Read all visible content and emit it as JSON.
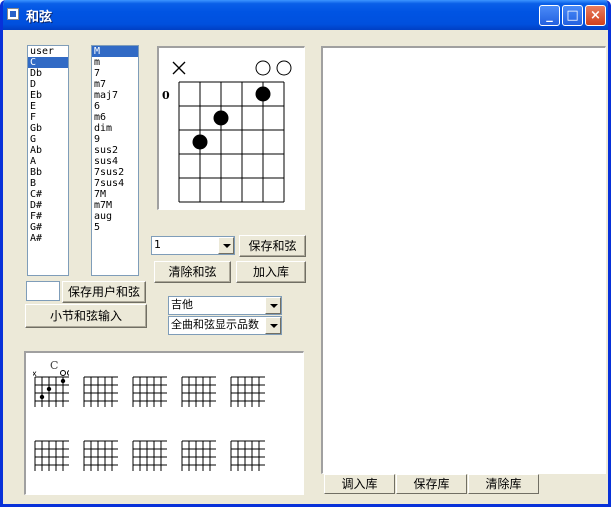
{
  "window": {
    "title": "和弦",
    "min_label": "_",
    "max_label": "□",
    "close_label": "×"
  },
  "root_list": {
    "items": [
      "user",
      "C",
      "Db",
      "D",
      "Eb",
      "E",
      "F",
      "Gb",
      "G",
      "Ab",
      "A",
      "Bb",
      "B",
      "C#",
      "D#",
      "F#",
      "G#",
      "A#"
    ],
    "selected": 1
  },
  "type_list": {
    "items": [
      "M",
      "m",
      "7",
      "m7",
      "maj7",
      "6",
      "m6",
      "dim",
      "9",
      "sus2",
      "sus4",
      "7sus2",
      "7sus4",
      "7M",
      "m7M",
      "aug",
      "5"
    ],
    "selected": 0
  },
  "chord_diagram": {
    "fret_label": "0",
    "strings": [
      "x",
      "",
      "",
      "",
      "o",
      "o"
    ],
    "dots": [
      {
        "string": 5,
        "fret": 1
      },
      {
        "string": 3,
        "fret": 2
      },
      {
        "string": 2,
        "fret": 3
      }
    ]
  },
  "fret_select": {
    "value": "1"
  },
  "buttons": {
    "save_chord": "保存和弦",
    "clear_chord": "清除和弦",
    "add_library": "加入库",
    "save_user_chord": "保存用户和弦",
    "measure_input": "小节和弦输入"
  },
  "user_chord_input": {
    "value": ""
  },
  "instrument_select": {
    "value": "吉他"
  },
  "display_select": {
    "value": "全曲和弦显示品数"
  },
  "mini_chords": {
    "first_label": "C",
    "first_marks": [
      "x",
      "o",
      "o"
    ]
  },
  "library_tabs": [
    "调入库",
    "保存库",
    "清除库"
  ]
}
